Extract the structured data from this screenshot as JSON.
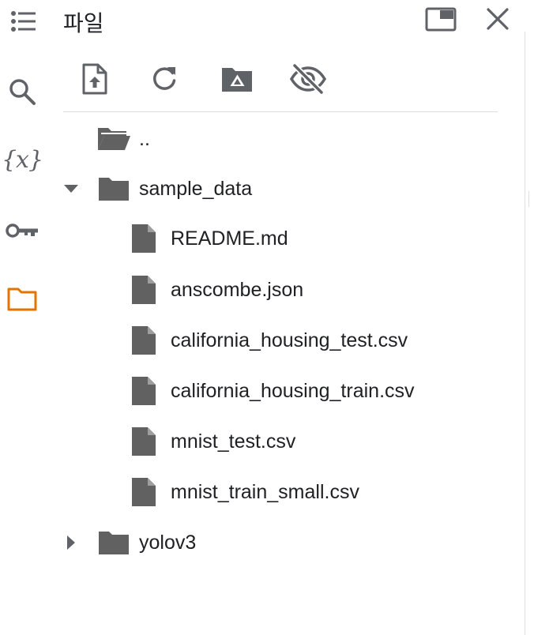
{
  "colors": {
    "icon": "#5f6368",
    "folder": "#616161",
    "active": "#e37400"
  },
  "rail": {
    "items": [
      {
        "icon": "toc-icon"
      },
      {
        "icon": "search-icon"
      },
      {
        "icon": "variables-icon",
        "glyph": "{x}"
      },
      {
        "icon": "key-icon"
      },
      {
        "icon": "folder-icon",
        "active": true
      }
    ]
  },
  "panel": {
    "title": "파일"
  },
  "header_buttons": [
    {
      "icon": "move-to-tab-icon"
    },
    {
      "icon": "close-icon"
    }
  ],
  "toolbar": [
    {
      "icon": "upload-file-icon"
    },
    {
      "icon": "refresh-icon"
    },
    {
      "icon": "mount-drive-icon"
    },
    {
      "icon": "hide-hidden-files-icon"
    }
  ],
  "tree": [
    {
      "label": "..",
      "type": "folder-open",
      "depth": 0
    },
    {
      "label": "sample_data",
      "type": "folder",
      "depth": 0,
      "expanded": true
    },
    {
      "label": "README.md",
      "type": "file",
      "depth": 1
    },
    {
      "label": "anscombe.json",
      "type": "file",
      "depth": 1
    },
    {
      "label": "california_housing_test.csv",
      "type": "file",
      "depth": 1
    },
    {
      "label": "california_housing_train.csv",
      "type": "file",
      "depth": 1
    },
    {
      "label": "mnist_test.csv",
      "type": "file",
      "depth": 1
    },
    {
      "label": "mnist_train_small.csv",
      "type": "file",
      "depth": 1
    },
    {
      "label": "yolov3",
      "type": "folder",
      "depth": 0,
      "expanded": false
    }
  ]
}
